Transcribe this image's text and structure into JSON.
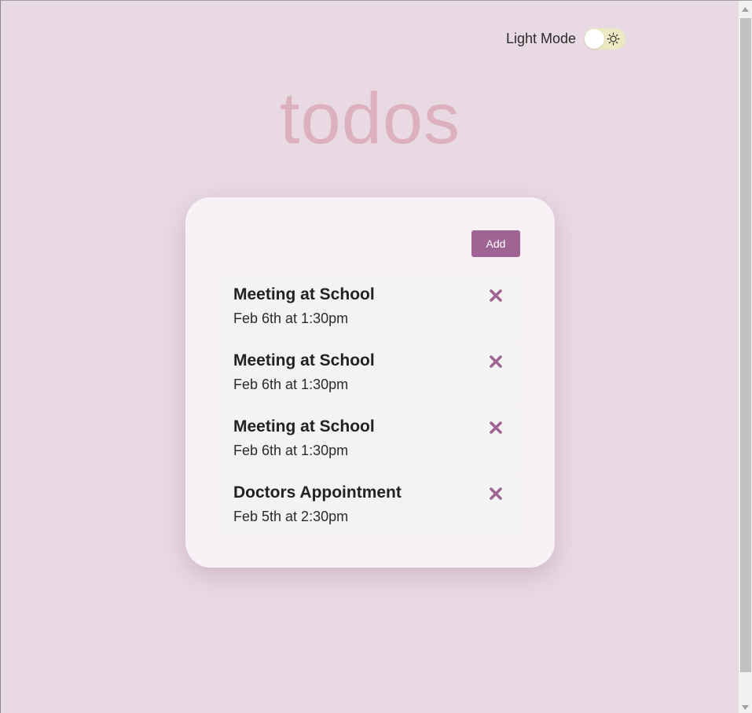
{
  "header": {
    "mode_label": "Light Mode",
    "mode_toggle_icon": "sun-icon",
    "mode_toggle_on": false
  },
  "app": {
    "title": "todos",
    "add_label": "Add"
  },
  "todos": [
    {
      "title": "Meeting at School",
      "date": "Feb 6th at 1:30pm"
    },
    {
      "title": "Meeting at School",
      "date": "Feb 6th at 1:30pm"
    },
    {
      "title": "Meeting at School",
      "date": "Feb 6th at 1:30pm"
    },
    {
      "title": "Doctors Appointment",
      "date": "Feb 5th at 2:30pm"
    }
  ],
  "colors": {
    "background": "#e8d9e3",
    "title": "#dcb1bd",
    "card": "#f8f1f5",
    "accent": "#a06494",
    "item_background": "#f3f3f3",
    "toggle_track": "#ede9c3"
  }
}
